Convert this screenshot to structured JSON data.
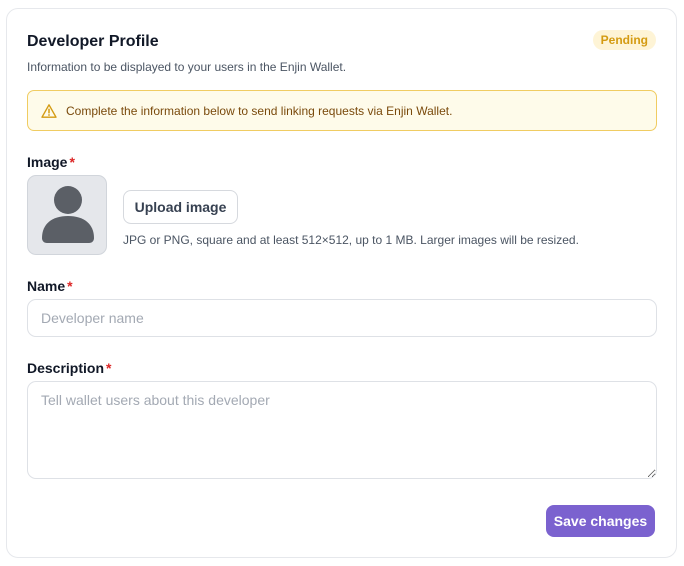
{
  "profile": {
    "title": "Developer Profile",
    "subtitle": "Information to be displayed to your users in the Enjin Wallet.",
    "status_badge": "Pending"
  },
  "alert": {
    "icon": "warning-triangle-icon",
    "text": "Complete the information below to send linking requests via Enjin Wallet."
  },
  "image_field": {
    "label": "Image",
    "required_marker": "*",
    "avatar_icon": "user-placeholder-icon",
    "upload_label": "Upload image",
    "hint": "JPG or PNG, square and at least 512×512, up to 1 MB. Larger images will be resized."
  },
  "name_field": {
    "label": "Name",
    "required_marker": "*",
    "value": "",
    "placeholder": "Developer name"
  },
  "description_field": {
    "label": "Description",
    "required_marker": "*",
    "value": "",
    "placeholder": "Tell wallet users about this developer"
  },
  "actions": {
    "save_label": "Save changes"
  },
  "colors": {
    "accent": "#7b62cf",
    "badge_bg": "#fef4d6",
    "badge_text": "#d49b12",
    "alert_border": "#f0cc62",
    "alert_bg": "#fefbea",
    "required": "#dc2626"
  }
}
